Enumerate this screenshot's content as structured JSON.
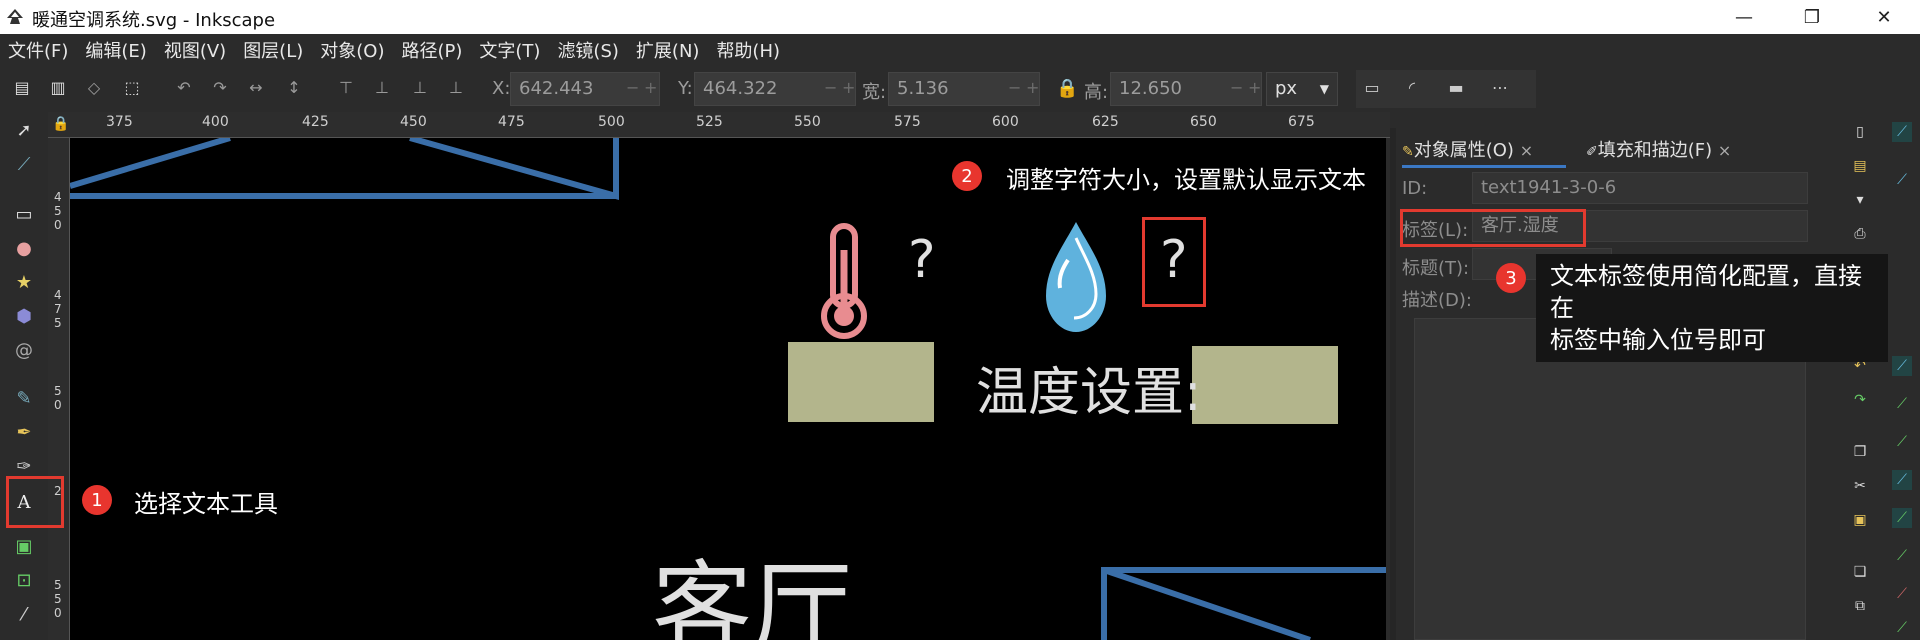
{
  "window": {
    "title": "暖通空调系统.svg - Inkscape",
    "minimize": "—",
    "maximize": "❐",
    "close": "✕"
  },
  "menu": [
    "文件(F)",
    "编辑(E)",
    "视图(V)",
    "图层(L)",
    "对象(O)",
    "路径(P)",
    "文字(T)",
    "滤镜(S)",
    "扩展(N)",
    "帮助(H)"
  ],
  "toolbar": {
    "x_label": "X:",
    "x_value": "642.443",
    "y_label": "Y:",
    "y_value": "464.322",
    "w_label": "宽:",
    "w_value": "5.136",
    "h_label": "高:",
    "h_value": "12.650",
    "unit": "px",
    "spin_minus": "−",
    "spin_plus": "+"
  },
  "ruler": {
    "ticks": [
      "375",
      "400",
      "425",
      "450",
      "475",
      "500",
      "525",
      "550",
      "575",
      "600",
      "625",
      "650",
      "675"
    ],
    "vertical": [
      "4",
      "5",
      "0",
      "4",
      "7",
      "5",
      "5",
      "0",
      "2",
      "5",
      "5",
      "0"
    ]
  },
  "canvas": {
    "question_temp": "?",
    "question_humidity": "?",
    "temp_setting_label": "温度设置:",
    "room_label": "客厅"
  },
  "panel": {
    "tab_object_props": "对象属性(O)",
    "tab_fill_stroke": "填充和描边(F)",
    "tab_close": "×",
    "id_label": "ID:",
    "id_value": "text1941-3-0-6",
    "label_label": "标签(L):",
    "label_value": "客厅.湿度",
    "title_label": "标题(T):",
    "desc_label": "描述(D):"
  },
  "annotations": {
    "step1_number": "1",
    "step1_text": "选择文本工具",
    "step2_number": "2",
    "step2_text": "调整字符大小，设置默认显示文本",
    "step3_number": "3",
    "step3_text_line1": "文本标签使用简化配置，直接在",
    "step3_text_line2": "标签中输入位号即可"
  },
  "colors": {
    "annotation_red": "#e23a2f",
    "canvas_bg": "#000000",
    "blue_line": "#3a6ea8",
    "box_fill": "#b3b58c",
    "thermometer": "#e88c90",
    "water_drop": "#5fb2dd"
  }
}
